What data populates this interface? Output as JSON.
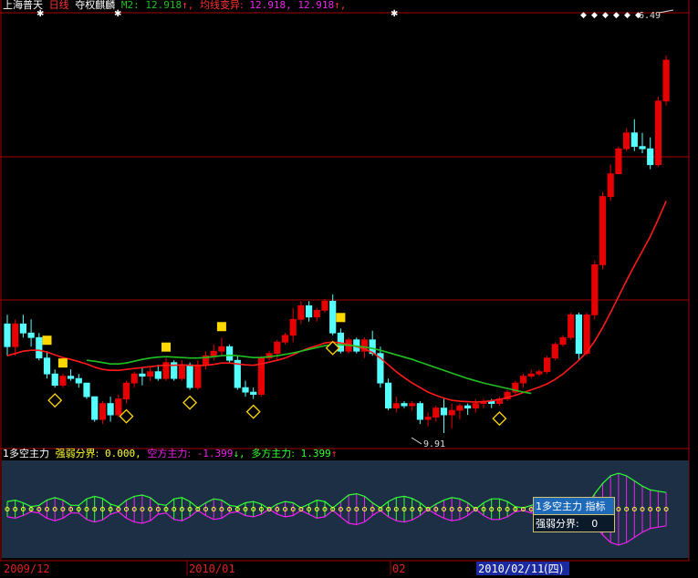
{
  "header": {
    "stock_name": "上海普天",
    "period": "日线",
    "adjust": "夺权麒麟",
    "ma_label": "M2:",
    "ma_value": "12.918",
    "ma_arrow": "↑,",
    "avgvar_label": "均线变异:",
    "avgvar_value": "12.918",
    "avgvar_value2": "12.918",
    "arrow_up": "↑,"
  },
  "indicator_header": {
    "name": "1多空主力",
    "threshold_label": "强弱分界:",
    "threshold_value": "0.000,",
    "bear_label": "空方主力:",
    "bear_value": "-1.399",
    "bear_arrow": "↓,",
    "bull_label": "多方主力:",
    "bull_value": "1.399",
    "bull_arrow": "↑"
  },
  "tooltip": {
    "title": "1多空主力 指标",
    "row_label": "强弱分界:",
    "row_value": "0"
  },
  "x_axis": {
    "labels": [
      "2009/12",
      "2010/01",
      "02"
    ],
    "cursor_date": "2010/02/11",
    "cursor_weekday": "(四)"
  },
  "markers": {
    "high_label": "6.49",
    "low_label": "9.91"
  },
  "colors": {
    "up": "#e60000",
    "down": "#55ffff",
    "ma_red": "#ff1a1a",
    "ma_green": "#20c020",
    "bull": "#33ff33",
    "bear": "#ee22ee",
    "sub_bg": "#1c2f45",
    "axis": "#a00000"
  },
  "chart_data": [
    {
      "type": "candlestick",
      "ohlc": [
        [
          11.7,
          11.9,
          11.0,
          11.2
        ],
        [
          11.2,
          11.8,
          11.0,
          11.7
        ],
        [
          11.7,
          11.9,
          11.4,
          11.5
        ],
        [
          11.5,
          11.8,
          11.2,
          11.4
        ],
        [
          11.4,
          11.5,
          10.9,
          10.95
        ],
        [
          10.95,
          11.1,
          10.5,
          10.6
        ],
        [
          10.6,
          10.7,
          10.3,
          10.35
        ],
        [
          10.35,
          10.6,
          10.3,
          10.55
        ],
        [
          10.55,
          10.7,
          10.45,
          10.5
        ],
        [
          10.5,
          10.6,
          10.3,
          10.4
        ],
        [
          10.4,
          10.4,
          10.05,
          10.1
        ],
        [
          10.1,
          10.1,
          9.55,
          9.6
        ],
        [
          9.6,
          10.0,
          9.5,
          9.95
        ],
        [
          9.95,
          10.1,
          9.55,
          9.7
        ],
        [
          9.7,
          10.15,
          9.65,
          10.05
        ],
        [
          10.05,
          10.45,
          9.95,
          10.4
        ],
        [
          10.4,
          10.65,
          10.3,
          10.6
        ],
        [
          10.6,
          10.75,
          10.35,
          10.55
        ],
        [
          10.55,
          10.75,
          10.45,
          10.65
        ],
        [
          10.65,
          10.8,
          10.45,
          10.5
        ],
        [
          10.5,
          10.95,
          10.45,
          10.85
        ],
        [
          10.85,
          10.9,
          10.45,
          10.5
        ],
        [
          10.5,
          10.9,
          10.45,
          10.8
        ],
        [
          10.8,
          10.85,
          10.25,
          10.3
        ],
        [
          10.3,
          10.9,
          10.25,
          10.8
        ],
        [
          10.8,
          11.1,
          10.7,
          11.0
        ],
        [
          11.0,
          11.25,
          10.9,
          11.1
        ],
        [
          11.1,
          11.4,
          11.0,
          11.2
        ],
        [
          11.2,
          11.25,
          10.85,
          10.9
        ],
        [
          10.9,
          11.0,
          10.25,
          10.3
        ],
        [
          10.3,
          10.45,
          10.1,
          10.2
        ],
        [
          10.2,
          10.3,
          10.05,
          10.15
        ],
        [
          10.15,
          11.0,
          10.1,
          10.95
        ],
        [
          10.95,
          11.1,
          10.9,
          11.05
        ],
        [
          11.05,
          11.35,
          10.9,
          11.3
        ],
        [
          11.3,
          11.5,
          11.25,
          11.45
        ],
        [
          11.45,
          12.05,
          11.3,
          11.8
        ],
        [
          11.8,
          12.2,
          11.7,
          12.1
        ],
        [
          12.1,
          12.2,
          11.75,
          11.85
        ],
        [
          11.85,
          12.05,
          11.75,
          12.0
        ],
        [
          12.0,
          12.25,
          11.95,
          12.2
        ],
        [
          12.2,
          12.35,
          11.45,
          11.5
        ],
        [
          11.5,
          11.6,
          11.05,
          11.1
        ],
        [
          11.1,
          11.4,
          11.05,
          11.35
        ],
        [
          11.35,
          11.4,
          11.05,
          11.1
        ],
        [
          11.1,
          11.4,
          10.95,
          11.35
        ],
        [
          11.35,
          11.55,
          11.0,
          11.05
        ],
        [
          11.05,
          11.2,
          10.3,
          10.4
        ],
        [
          10.4,
          10.5,
          9.8,
          9.85
        ],
        [
          9.85,
          10.1,
          9.75,
          9.95
        ],
        [
          9.95,
          10.0,
          9.85,
          9.9
        ],
        [
          9.9,
          10.0,
          9.8,
          9.95
        ],
        [
          9.95,
          10.0,
          9.5,
          9.6
        ],
        [
          9.6,
          9.75,
          9.45,
          9.65
        ],
        [
          9.65,
          9.9,
          9.55,
          9.85
        ],
        [
          9.85,
          10.05,
          9.3,
          9.7
        ],
        [
          9.7,
          9.95,
          9.4,
          9.8
        ],
        [
          9.8,
          9.95,
          9.6,
          9.9
        ],
        [
          9.9,
          9.95,
          9.7,
          9.85
        ],
        [
          9.85,
          10.05,
          9.75,
          9.95
        ],
        [
          9.95,
          10.05,
          9.85,
          10.0
        ],
        [
          10.0,
          10.05,
          9.85,
          9.95
        ],
        [
          9.95,
          10.1,
          9.9,
          10.05
        ],
        [
          10.05,
          10.25,
          10.0,
          10.2
        ],
        [
          10.2,
          10.45,
          10.15,
          10.4
        ],
        [
          10.4,
          10.6,
          10.3,
          10.55
        ],
        [
          10.55,
          10.7,
          10.5,
          10.6
        ],
        [
          10.6,
          10.7,
          10.55,
          10.65
        ],
        [
          10.65,
          11.0,
          10.6,
          10.95
        ],
        [
          10.95,
          11.3,
          10.9,
          11.25
        ],
        [
          11.25,
          11.45,
          11.2,
          11.4
        ],
        [
          11.4,
          11.95,
          11.35,
          11.9
        ],
        [
          11.9,
          11.95,
          10.9,
          11.05
        ],
        [
          11.05,
          11.95,
          11.0,
          11.9
        ],
        [
          11.9,
          13.1,
          11.8,
          13.0
        ],
        [
          13.0,
          14.6,
          12.9,
          14.5
        ],
        [
          14.5,
          15.2,
          14.4,
          15.0
        ],
        [
          15.0,
          15.6,
          15.0,
          15.55
        ],
        [
          15.55,
          16.0,
          15.5,
          15.9
        ],
        [
          15.9,
          16.2,
          15.5,
          15.6
        ],
        [
          15.6,
          15.9,
          15.45,
          15.55
        ],
        [
          15.55,
          15.8,
          15.1,
          15.2
        ],
        [
          15.2,
          16.7,
          15.15,
          16.6
        ],
        [
          16.6,
          17.6,
          16.5,
          17.5
        ]
      ],
      "ma_red": [
        11.0,
        11.05,
        11.1,
        11.12,
        11.12,
        11.08,
        11.02,
        10.96,
        10.92,
        10.87,
        10.82,
        10.75,
        10.7,
        10.68,
        10.68,
        10.7,
        10.72,
        10.74,
        10.76,
        10.78,
        10.79,
        10.79,
        10.8,
        10.79,
        10.78,
        10.79,
        10.81,
        10.84,
        10.84,
        10.82,
        10.8,
        10.79,
        10.82,
        10.86,
        10.9,
        10.95,
        11.02,
        11.1,
        11.17,
        11.22,
        11.28,
        11.3,
        11.28,
        11.25,
        11.2,
        11.15,
        11.07,
        10.95,
        10.8,
        10.65,
        10.52,
        10.4,
        10.3,
        10.2,
        10.13,
        10.07,
        10.02,
        10.0,
        9.99,
        9.98,
        9.99,
        10.01,
        10.04,
        10.08,
        10.13,
        10.19,
        10.25,
        10.31,
        10.38,
        10.48,
        10.6,
        10.75,
        10.9,
        11.08,
        11.32,
        11.62,
        11.95,
        12.3,
        12.65,
        12.98,
        13.3,
        13.62,
        14.0,
        14.4
      ],
      "ma_green": [
        null,
        null,
        null,
        null,
        null,
        null,
        null,
        null,
        null,
        null,
        10.9,
        10.88,
        10.85,
        10.82,
        10.82,
        10.84,
        10.88,
        10.92,
        10.95,
        10.97,
        10.98,
        10.97,
        10.96,
        10.95,
        10.95,
        10.96,
        10.98,
        11.0,
        11.01,
        11.0,
        10.98,
        10.96,
        10.96,
        10.98,
        11.0,
        11.03,
        11.06,
        11.1,
        11.14,
        11.18,
        11.22,
        11.24,
        11.24,
        11.23,
        11.21,
        11.19,
        11.16,
        11.12,
        11.07,
        11.02,
        10.97,
        10.92,
        10.86,
        10.8,
        10.74,
        10.68,
        10.62,
        10.56,
        10.5,
        10.45,
        10.4,
        10.36,
        10.32,
        10.28,
        10.24,
        10.2,
        10.17,
        null,
        null,
        null,
        null,
        null,
        null,
        null,
        null,
        null,
        null,
        null,
        null,
        null,
        null,
        null,
        null,
        null
      ],
      "ylim": [
        9.0,
        18.5
      ]
    },
    {
      "type": "area",
      "title": "1多空主力",
      "threshold": 0,
      "values": [
        0.3,
        0.35,
        0.25,
        0.1,
        -0.15,
        -0.35,
        -0.45,
        -0.35,
        -0.15,
        0.15,
        0.4,
        0.5,
        0.42,
        0.2,
        -0.1,
        -0.35,
        -0.5,
        -0.55,
        -0.45,
        -0.2,
        0.15,
        0.4,
        0.45,
        0.3,
        0.05,
        -0.25,
        -0.4,
        -0.35,
        -0.15,
        0.1,
        0.25,
        0.3,
        0.2,
        0.0,
        -0.2,
        -0.3,
        -0.25,
        -0.05,
        0.2,
        0.35,
        0.3,
        0.05,
        -0.3,
        -0.55,
        -0.6,
        -0.5,
        -0.25,
        0.05,
        0.3,
        0.45,
        0.5,
        0.42,
        0.25,
        0.0,
        -0.2,
        -0.35,
        -0.45,
        -0.4,
        -0.25,
        0.0,
        0.25,
        0.4,
        0.4,
        0.3,
        0.1,
        -0.05,
        -0.15,
        -0.2,
        -0.1,
        0.0,
        0.15,
        0.2,
        0.15,
        -0.1,
        -0.6,
        -1.0,
        -1.3,
        -1.4,
        -1.3,
        -1.1,
        -0.9,
        -0.75,
        -0.7,
        -0.65
      ],
      "ylim": [
        -1.9,
        1.9
      ]
    }
  ]
}
